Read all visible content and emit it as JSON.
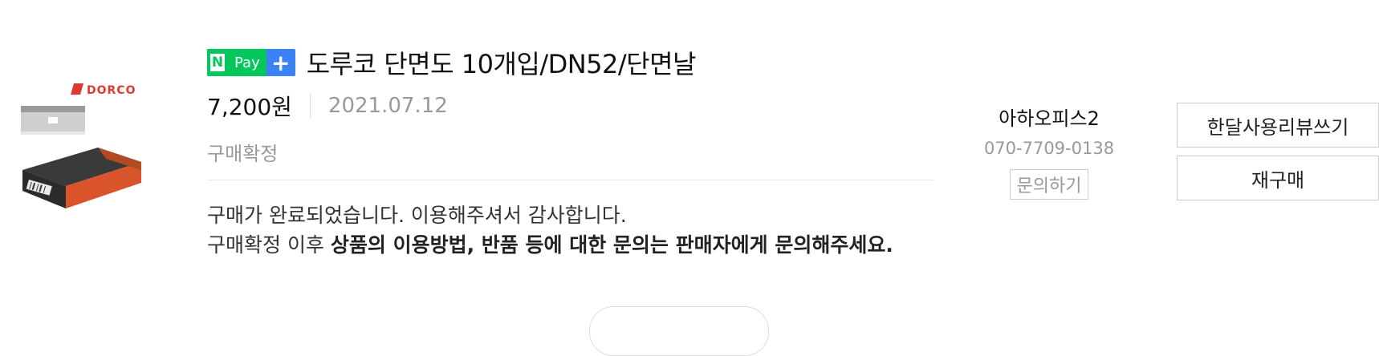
{
  "product": {
    "brand_logo_text": "DORCO",
    "title": "도루코 단면도 10개입/DN52/단면날",
    "badge": {
      "n": "N",
      "pay": "Pay",
      "plus": "+"
    },
    "price": "7,200원",
    "order_date": "2021.07.12",
    "status": "구매확정"
  },
  "message": {
    "line1": "구매가 완료되었습니다. 이용해주셔서 감사합니다.",
    "line2_prefix": "구매확정 이후 ",
    "line2_bold": "상품의 이용방법, 반품 등에 대한 문의는 판매자에게 문의해주세요."
  },
  "seller": {
    "name": "아하오피스2",
    "phone": "070-7709-0138",
    "inquiry_label": "문의하기"
  },
  "actions": {
    "review_label": "한달사용리뷰쓰기",
    "rebuy_label": "재구매"
  },
  "colors": {
    "npay_green": "#03c75a",
    "plus_blue": "#3b82f6",
    "dorco_red": "#e03a2f",
    "pack_orange": "#d9542b"
  }
}
